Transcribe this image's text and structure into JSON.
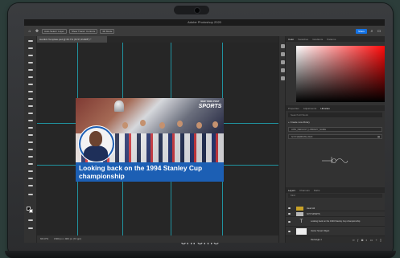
{
  "device": {
    "brand_label": "chrome"
  },
  "app": {
    "title": "Adobe Photoshop 2020",
    "options_bar": {
      "home_icon": "home-icon",
      "move_tool_icon": "move-icon",
      "auto_select_label": "Auto-Select: Layer",
      "transform_label": "Show Transf. Controls",
      "mode_3d_label": "3D Mode",
      "share_label": "Share"
    },
    "document_tab": "Hardick Template.psd @ 66.7% (NYP, RGB/8*) *",
    "status_bar": {
      "zoom": "66.67%",
      "doc_info": "1500 px x 960 px (72 ppi)"
    }
  },
  "artwork": {
    "logo_top": "NEW YORK POST",
    "logo_main": "SPORTS",
    "headline": "Looking back on the 1994 Stanley Cup championship"
  },
  "right_panel": {
    "color_tabs": [
      "Color",
      "Swatches",
      "Gradients",
      "Patterns"
    ],
    "library_tabs": [
      "Properties",
      "Adjustments",
      "Libraries"
    ],
    "library": {
      "search_placeholder": "Search All Stock",
      "create_label": "+ Create new library",
      "library_name_field": "LIBS_DEFAULT_LIBRARY_NAME",
      "current_library": "NYP-WEBSITE 2020"
    },
    "layers_tabs": [
      "Layers",
      "Channels",
      "Paths"
    ],
    "layers_filter": "Kind",
    "layers": [
      {
        "name": "Head Hd",
        "thumb": "folder"
      },
      {
        "name": "NYP SPORTS",
        "thumb": "folder"
      },
      {
        "name": "Looking back on the 1994 Stanley Cup championship",
        "thumb": "text"
      },
      {
        "name": "Vector Smart Object",
        "thumb": "image"
      },
      {
        "name": "Rectangle 1",
        "thumb": "image"
      }
    ]
  },
  "colors": {
    "accent_blue": "#1473e6",
    "guide": "#1fb8c9",
    "caption_blue": "#1c5fb4"
  }
}
